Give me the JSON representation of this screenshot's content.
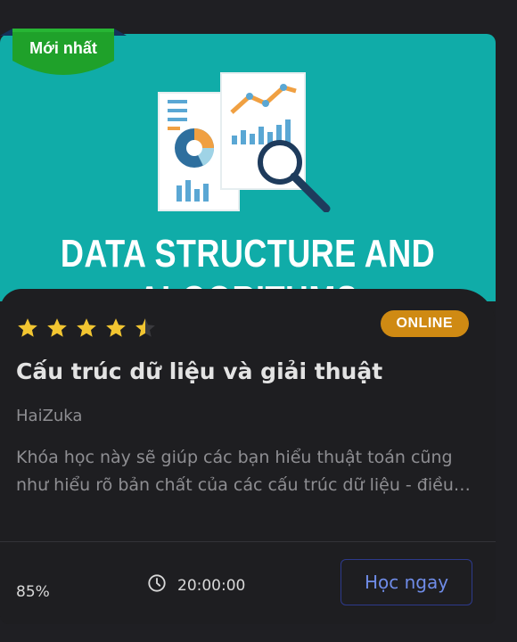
{
  "thumbnail": {
    "title_line1": "DATA STRUCTURE AND",
    "title_line2": "ALGORITHMS",
    "background_color": "#10aca8"
  },
  "ribbon": {
    "label": "Mới nhất",
    "color": "#1fa12a"
  },
  "course": {
    "rating": 4.5,
    "rating_max": 5,
    "mode_badge": "ONLINE",
    "title": "Cấu trúc dữ liệu và giải thuật",
    "author": "HaiZuka",
    "description_line1": "Khóa học này sẽ giúp các bạn hiểu thuật toán cũng",
    "description_line2": "như hiểu rõ bản chất của các cấu trúc dữ liệu - điều…"
  },
  "footer": {
    "progress": "85%",
    "duration": "20:00:00",
    "duration_icon": "clock-icon",
    "learn_button": "Học ngay"
  },
  "colors": {
    "accent_badge": "#cf8a13",
    "star": "#f2c531",
    "button_text": "#6f8ce8",
    "button_border": "#2d3a8c"
  }
}
